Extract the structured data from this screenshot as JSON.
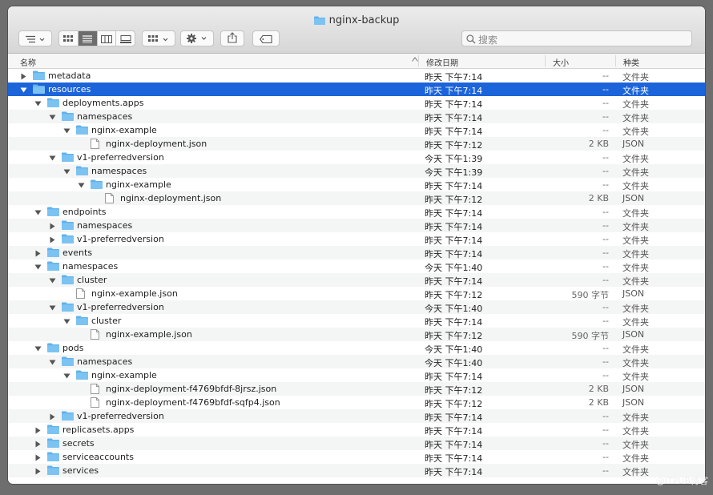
{
  "window": {
    "title": "nginx-backup"
  },
  "toolbar": {
    "search_placeholder": "搜索",
    "icons": [
      "list-sort-icon",
      "icon-view-icon",
      "list-view-icon",
      "column-view-icon",
      "gallery-view-icon",
      "group-icon",
      "gear-icon",
      "share-icon",
      "tag-icon"
    ]
  },
  "columns": {
    "name": "名称",
    "date": "修改日期",
    "size": "大小",
    "kind": "种类"
  },
  "rows": [
    {
      "name": "metadata",
      "date": "昨天 下午7:14",
      "size": "--",
      "kind": "文件夹",
      "depth": 0,
      "type": "folder",
      "expanded": false
    },
    {
      "name": "resources",
      "date": "昨天 下午7:14",
      "size": "--",
      "kind": "文件夹",
      "depth": 0,
      "type": "folder",
      "expanded": true,
      "selected": true
    },
    {
      "name": "deployments.apps",
      "date": "昨天 下午7:14",
      "size": "--",
      "kind": "文件夹",
      "depth": 1,
      "type": "folder",
      "expanded": true
    },
    {
      "name": "namespaces",
      "date": "昨天 下午7:14",
      "size": "--",
      "kind": "文件夹",
      "depth": 2,
      "type": "folder",
      "expanded": true
    },
    {
      "name": "nginx-example",
      "date": "昨天 下午7:14",
      "size": "--",
      "kind": "文件夹",
      "depth": 3,
      "type": "folder",
      "expanded": true
    },
    {
      "name": "nginx-deployment.json",
      "date": "昨天 下午7:12",
      "size": "2 KB",
      "kind": "JSON",
      "depth": 4,
      "type": "file"
    },
    {
      "name": "v1-preferredversion",
      "date": "今天 下午1:39",
      "size": "--",
      "kind": "文件夹",
      "depth": 2,
      "type": "folder",
      "expanded": true
    },
    {
      "name": "namespaces",
      "date": "今天 下午1:39",
      "size": "--",
      "kind": "文件夹",
      "depth": 3,
      "type": "folder",
      "expanded": true
    },
    {
      "name": "nginx-example",
      "date": "昨天 下午7:14",
      "size": "--",
      "kind": "文件夹",
      "depth": 4,
      "type": "folder",
      "expanded": true
    },
    {
      "name": "nginx-deployment.json",
      "date": "昨天 下午7:12",
      "size": "2 KB",
      "kind": "JSON",
      "depth": 5,
      "type": "file"
    },
    {
      "name": "endpoints",
      "date": "昨天 下午7:14",
      "size": "--",
      "kind": "文件夹",
      "depth": 1,
      "type": "folder",
      "expanded": true
    },
    {
      "name": "namespaces",
      "date": "昨天 下午7:14",
      "size": "--",
      "kind": "文件夹",
      "depth": 2,
      "type": "folder",
      "expanded": false
    },
    {
      "name": "v1-preferredversion",
      "date": "昨天 下午7:14",
      "size": "--",
      "kind": "文件夹",
      "depth": 2,
      "type": "folder",
      "expanded": false
    },
    {
      "name": "events",
      "date": "昨天 下午7:14",
      "size": "--",
      "kind": "文件夹",
      "depth": 1,
      "type": "folder",
      "expanded": false
    },
    {
      "name": "namespaces",
      "date": "今天 下午1:40",
      "size": "--",
      "kind": "文件夹",
      "depth": 1,
      "type": "folder",
      "expanded": true
    },
    {
      "name": "cluster",
      "date": "昨天 下午7:14",
      "size": "--",
      "kind": "文件夹",
      "depth": 2,
      "type": "folder",
      "expanded": true
    },
    {
      "name": "nginx-example.json",
      "date": "昨天 下午7:12",
      "size": "590 字节",
      "kind": "JSON",
      "depth": 3,
      "type": "file"
    },
    {
      "name": "v1-preferredversion",
      "date": "今天 下午1:40",
      "size": "--",
      "kind": "文件夹",
      "depth": 2,
      "type": "folder",
      "expanded": true
    },
    {
      "name": "cluster",
      "date": "昨天 下午7:14",
      "size": "--",
      "kind": "文件夹",
      "depth": 3,
      "type": "folder",
      "expanded": true
    },
    {
      "name": "nginx-example.json",
      "date": "昨天 下午7:12",
      "size": "590 字节",
      "kind": "JSON",
      "depth": 4,
      "type": "file"
    },
    {
      "name": "pods",
      "date": "今天 下午1:40",
      "size": "--",
      "kind": "文件夹",
      "depth": 1,
      "type": "folder",
      "expanded": true
    },
    {
      "name": "namespaces",
      "date": "今天 下午1:40",
      "size": "--",
      "kind": "文件夹",
      "depth": 2,
      "type": "folder",
      "expanded": true
    },
    {
      "name": "nginx-example",
      "date": "昨天 下午7:14",
      "size": "--",
      "kind": "文件夹",
      "depth": 3,
      "type": "folder",
      "expanded": true
    },
    {
      "name": "nginx-deployment-f4769bfdf-8jrsz.json",
      "date": "昨天 下午7:12",
      "size": "2 KB",
      "kind": "JSON",
      "depth": 4,
      "type": "file"
    },
    {
      "name": "nginx-deployment-f4769bfdf-sqfp4.json",
      "date": "昨天 下午7:12",
      "size": "2 KB",
      "kind": "JSON",
      "depth": 4,
      "type": "file"
    },
    {
      "name": "v1-preferredversion",
      "date": "昨天 下午7:14",
      "size": "--",
      "kind": "文件夹",
      "depth": 2,
      "type": "folder",
      "expanded": false
    },
    {
      "name": "replicasets.apps",
      "date": "昨天 下午7:14",
      "size": "--",
      "kind": "文件夹",
      "depth": 1,
      "type": "folder",
      "expanded": false
    },
    {
      "name": "secrets",
      "date": "昨天 下午7:14",
      "size": "--",
      "kind": "文件夹",
      "depth": 1,
      "type": "folder",
      "expanded": false
    },
    {
      "name": "serviceaccounts",
      "date": "昨天 下午7:14",
      "size": "--",
      "kind": "文件夹",
      "depth": 1,
      "type": "folder",
      "expanded": false
    },
    {
      "name": "services",
      "date": "昨天 下午7:14",
      "size": "--",
      "kind": "文件夹",
      "depth": 1,
      "type": "folder",
      "expanded": false
    }
  ],
  "watermark": "@ITPUB博客",
  "colors": {
    "selection": "#1c64d9",
    "folder": "#5fb2ec"
  }
}
